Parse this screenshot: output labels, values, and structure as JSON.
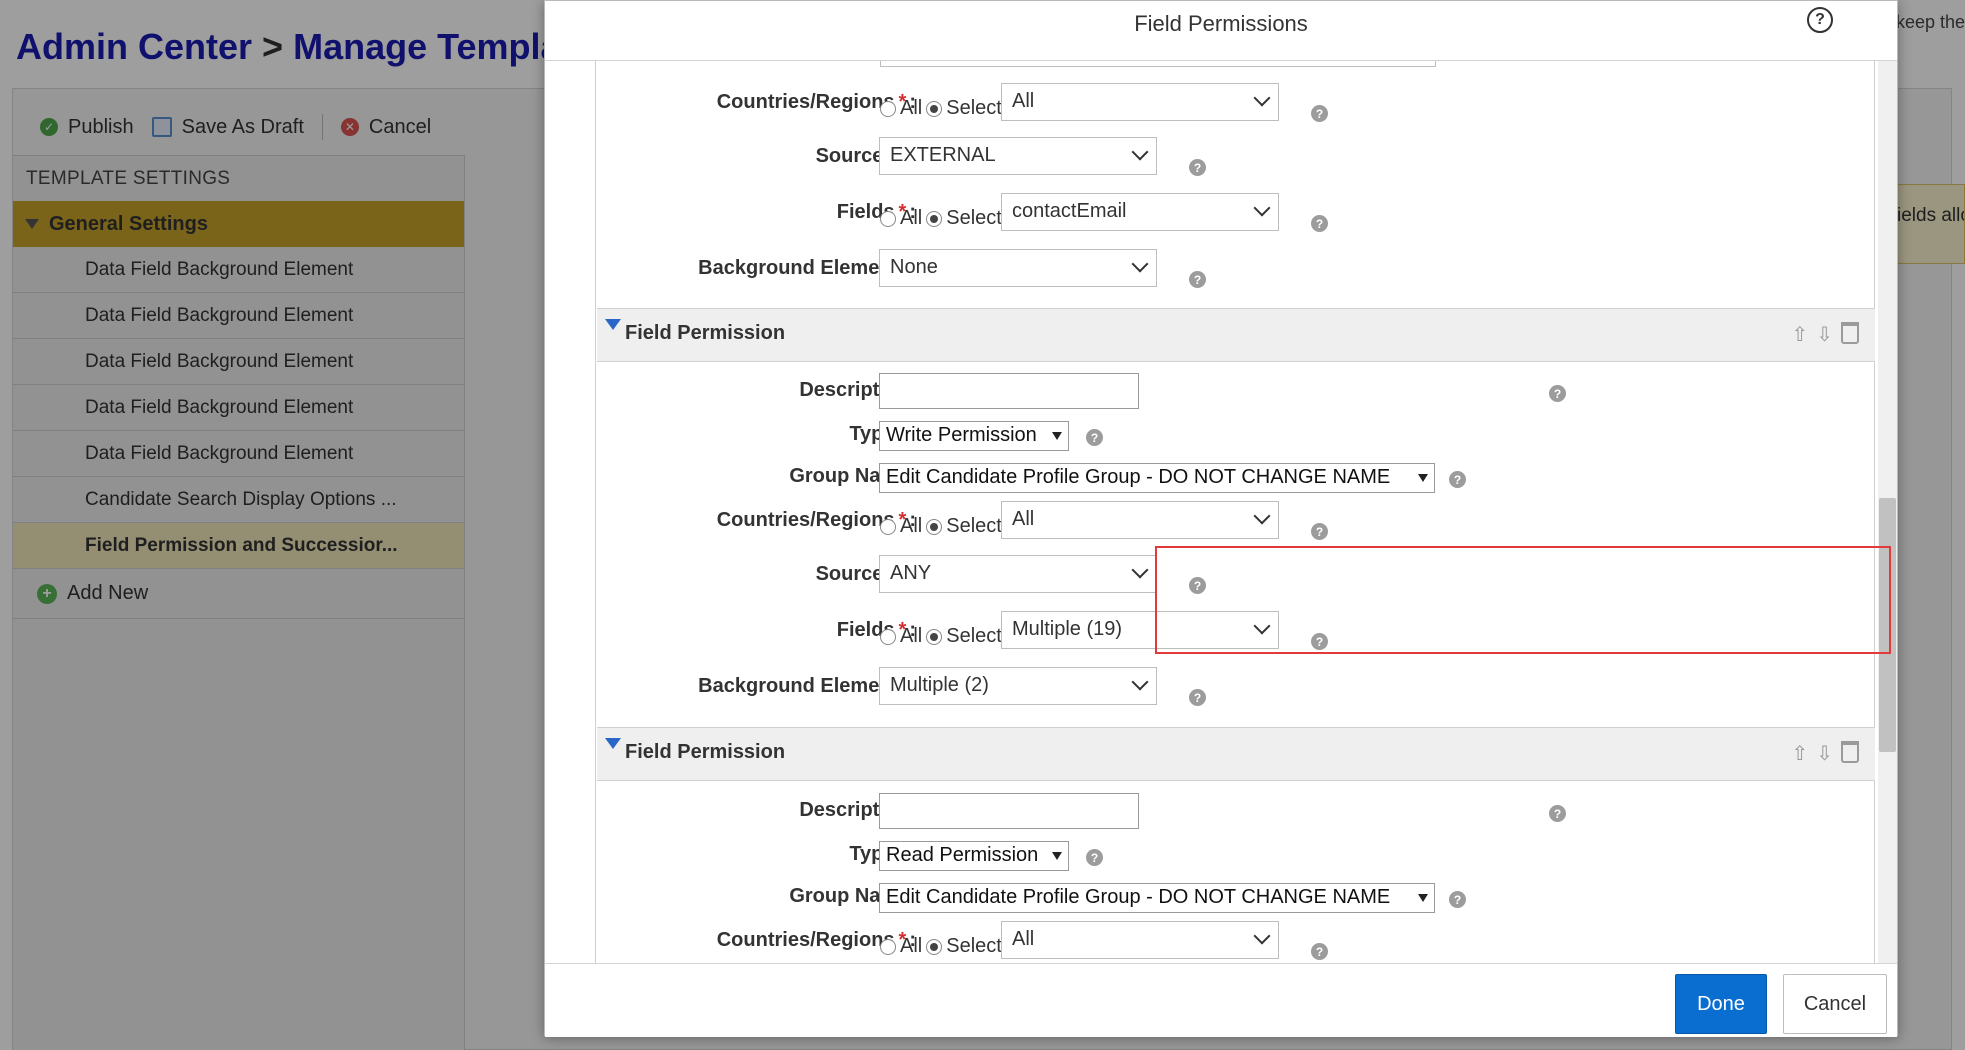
{
  "background": {
    "title_part1": "Admin Center",
    "title_separator": ">",
    "title_part2": "Manage Templa",
    "toolbar": {
      "publish_label": "Publish",
      "save_draft_label": "Save As Draft",
      "cancel_label": "Cancel"
    },
    "sidebar": {
      "heading": "TEMPLATE SETTINGS",
      "group_label": "General Settings",
      "items": [
        {
          "label": "Data Field Background Element"
        },
        {
          "label": "Data Field Background Element"
        },
        {
          "label": "Data Field Background Element"
        },
        {
          "label": "Data Field Background Element"
        },
        {
          "label": "Data Field Background Element"
        },
        {
          "label": "Candidate Search Display Options ..."
        },
        {
          "label": "Field Permission and Successior..."
        }
      ],
      "add_new_label": "Add New"
    },
    "right_text_top": "keep the",
    "right_text_banner": "ields allo"
  },
  "dialog": {
    "title": "Field Permissions",
    "help_icon": "question-circle-icon",
    "top_block": {
      "countries_label": "Countries/Regions",
      "countries_value": "All",
      "sources_label": "Sources",
      "sources_value": "EXTERNAL",
      "fields_label": "Fields",
      "fields_value": "contactEmail",
      "background_label": "Background Elements:",
      "background_value": "None"
    },
    "radio_all": "All",
    "radio_selected": "Selected",
    "required_mark": "*",
    "colon": ":",
    "section1": {
      "title": "Field Permission",
      "description_label": "Description:",
      "type_label": "Type",
      "type_value": "Write Permission",
      "group_label": "Group Name:",
      "group_value": "Edit Candidate Profile Group - DO NOT CHANGE NAME",
      "countries_label": "Countries/Regions",
      "countries_value": "All",
      "sources_label": "Sources",
      "sources_value": "ANY",
      "fields_label": "Fields",
      "fields_value": "Multiple (19)",
      "background_label": "Background Elements:",
      "background_value": "Multiple (2)"
    },
    "section2": {
      "title": "Field Permission",
      "description_label": "Description:",
      "type_label": "Type",
      "type_value": "Read Permission",
      "group_label": "Group Name:",
      "group_value": "Edit Candidate Profile Group - DO NOT CHANGE NAME",
      "countries_label": "Countries/Regions",
      "countries_value": "All"
    },
    "done_label": "Done",
    "cancel_label": "Cancel"
  },
  "colors": {
    "primary_button": "#0a6ed1",
    "highlight_border": "#e03a3a",
    "title_blue": "#1a1ab0",
    "group_gold": "#c5a22a"
  }
}
